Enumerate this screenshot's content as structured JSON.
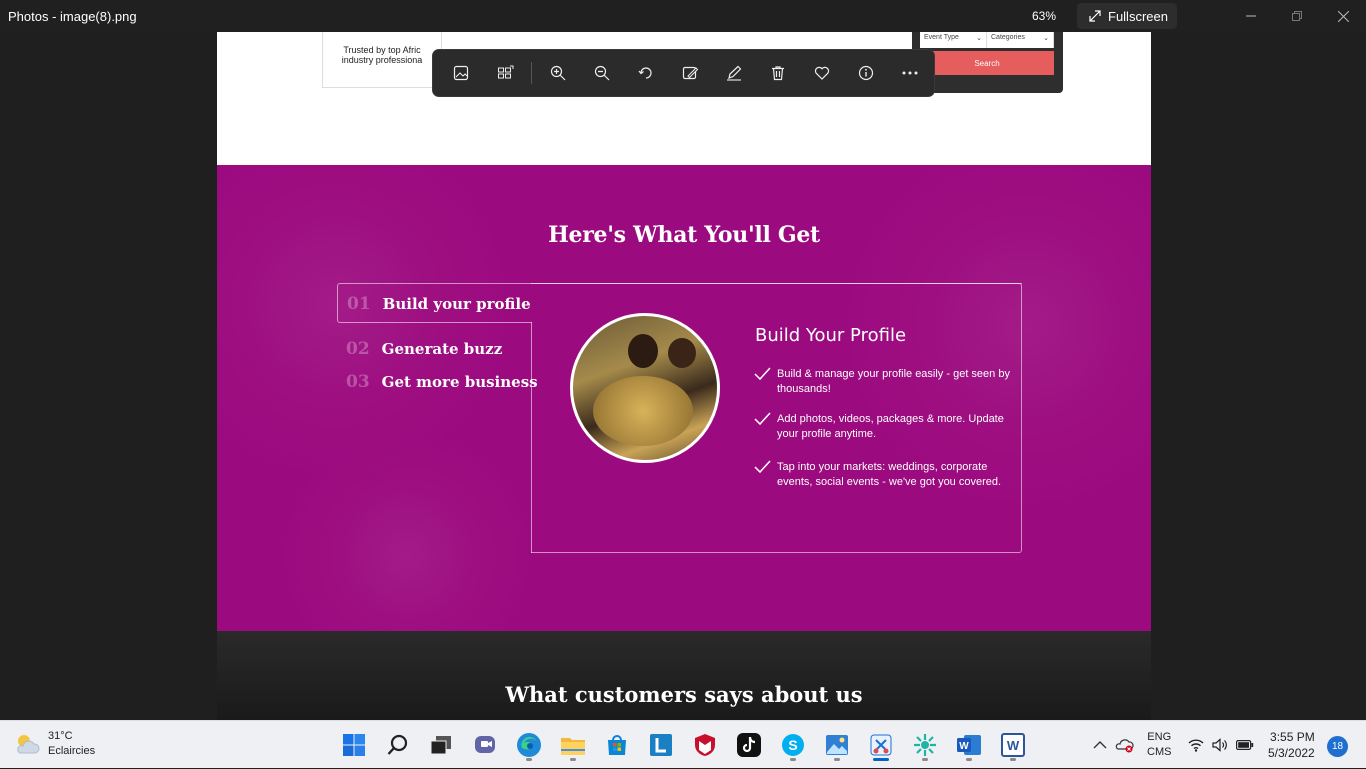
{
  "window": {
    "title": "Photos - image(8).png",
    "zoom": "63%",
    "fullscreen_label": "Fullscreen"
  },
  "toolbar": {
    "buttons": [
      "image-icon",
      "gallery-icon",
      "zoom-in-icon",
      "zoom-out-icon",
      "rotate-icon",
      "edit-image-icon",
      "draw-icon",
      "delete-icon",
      "favorite-icon",
      "info-icon",
      "more-icon"
    ]
  },
  "image": {
    "trusted_line1": "Trusted by top Afric",
    "trusted_line2": "industry professiona",
    "search": {
      "event_type": "Event Type",
      "categories": "Categories",
      "button": "Search"
    },
    "section_title": "Here's What You'll Get",
    "tabs": [
      {
        "num": "01",
        "label": "Build your profile"
      },
      {
        "num": "02",
        "label": "Generate buzz"
      },
      {
        "num": "03",
        "label": "Get more business"
      }
    ],
    "panel": {
      "title": "Build Your Profile",
      "bullets": [
        "Build & manage your profile easily - get seen by thousands!",
        "Add photos, videos, packages & more. Update your profile anytime.",
        "Tap into your markets: weddings, corporate events, social events - we've got you covered."
      ]
    },
    "testimonials_title": "What customers says about us",
    "colors": {
      "section_bg": "#9c0a7f",
      "search_button": "#e55d5d"
    }
  },
  "taskbar": {
    "weather_temp": "31°C",
    "weather_desc": "Eclaircies",
    "lang": "ENG",
    "layout": "CMS",
    "time": "3:55 PM",
    "date": "5/3/2022",
    "notifications": "18",
    "apps": [
      "start-icon",
      "search-icon",
      "task-view-icon",
      "teams-chat-icon",
      "edge-icon",
      "file-explorer-icon",
      "store-icon",
      "l-app-icon",
      "mcafee-icon",
      "tiktok-icon",
      "skype-icon",
      "photos-icon",
      "snipping-tool-icon",
      "app-icon",
      "word-icon",
      "word-alt-icon"
    ]
  }
}
